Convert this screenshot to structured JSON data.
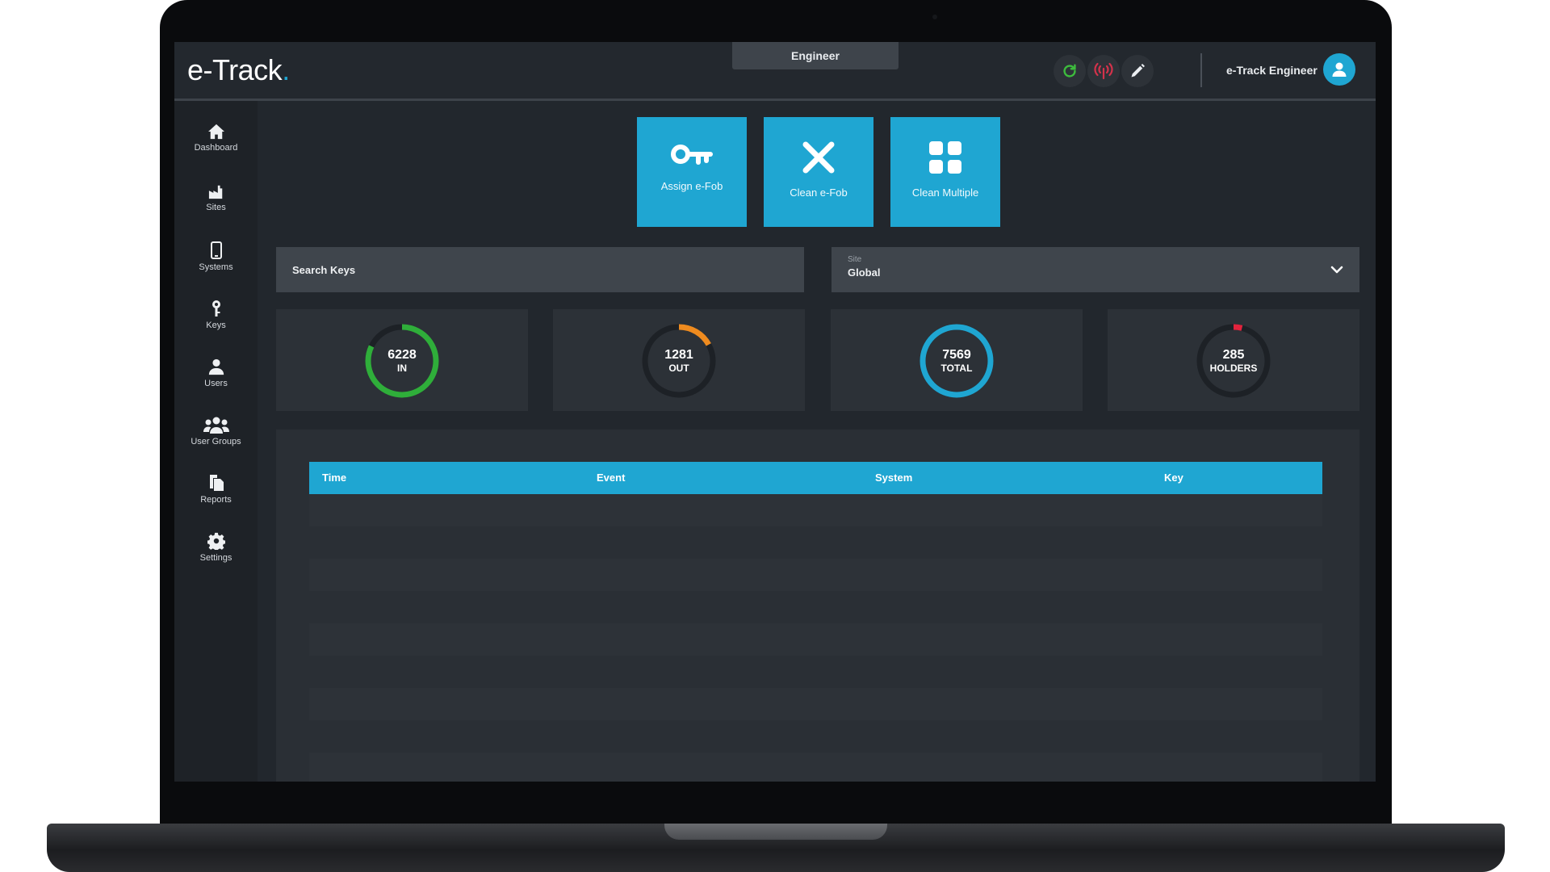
{
  "app": {
    "logo_text": "e-Track",
    "logo_dot": ".",
    "role": "Engineer",
    "user_name": "e-Track Engineer",
    "brand_color": "#1fa6d2"
  },
  "toolbar": {
    "icons": [
      "refresh-icon",
      "signal-icon",
      "edit-icon"
    ],
    "refresh_color": "#3dbb3d",
    "signal_color": "#d3324b"
  },
  "sidebar": {
    "items": [
      {
        "label": "Dashboard",
        "icon": "home-icon"
      },
      {
        "label": "Sites",
        "icon": "factory-icon"
      },
      {
        "label": "Systems",
        "icon": "device-icon"
      },
      {
        "label": "Keys",
        "icon": "key-icon"
      },
      {
        "label": "Users",
        "icon": "user-icon"
      },
      {
        "label": "User Groups",
        "icon": "group-icon"
      },
      {
        "label": "Reports",
        "icon": "reports-icon"
      },
      {
        "label": "Settings",
        "icon": "gear-icon"
      }
    ]
  },
  "actions": [
    {
      "label": "Assign e-Fob",
      "icon": "key-icon"
    },
    {
      "label": "Clean e-Fob",
      "icon": "x-icon"
    },
    {
      "label": "Clean Multiple",
      "icon": "grid-icon"
    }
  ],
  "search": {
    "placeholder": "Search Keys"
  },
  "site": {
    "label": "Site",
    "value": "Global"
  },
  "stats": [
    {
      "value": "6228",
      "label": "IN",
      "fraction": 0.82,
      "color": "#2fae3a"
    },
    {
      "value": "1281",
      "label": "OUT",
      "fraction": 0.17,
      "color": "#ee8b1f"
    },
    {
      "value": "7569",
      "label": "TOTAL",
      "fraction": 1.0,
      "color": "#1fa6d2"
    },
    {
      "value": "285",
      "label": "HOLDERS",
      "fraction": 0.04,
      "color": "#e2233d"
    }
  ],
  "table": {
    "columns": [
      "Time",
      "Event",
      "System",
      "Key"
    ],
    "rows": []
  }
}
